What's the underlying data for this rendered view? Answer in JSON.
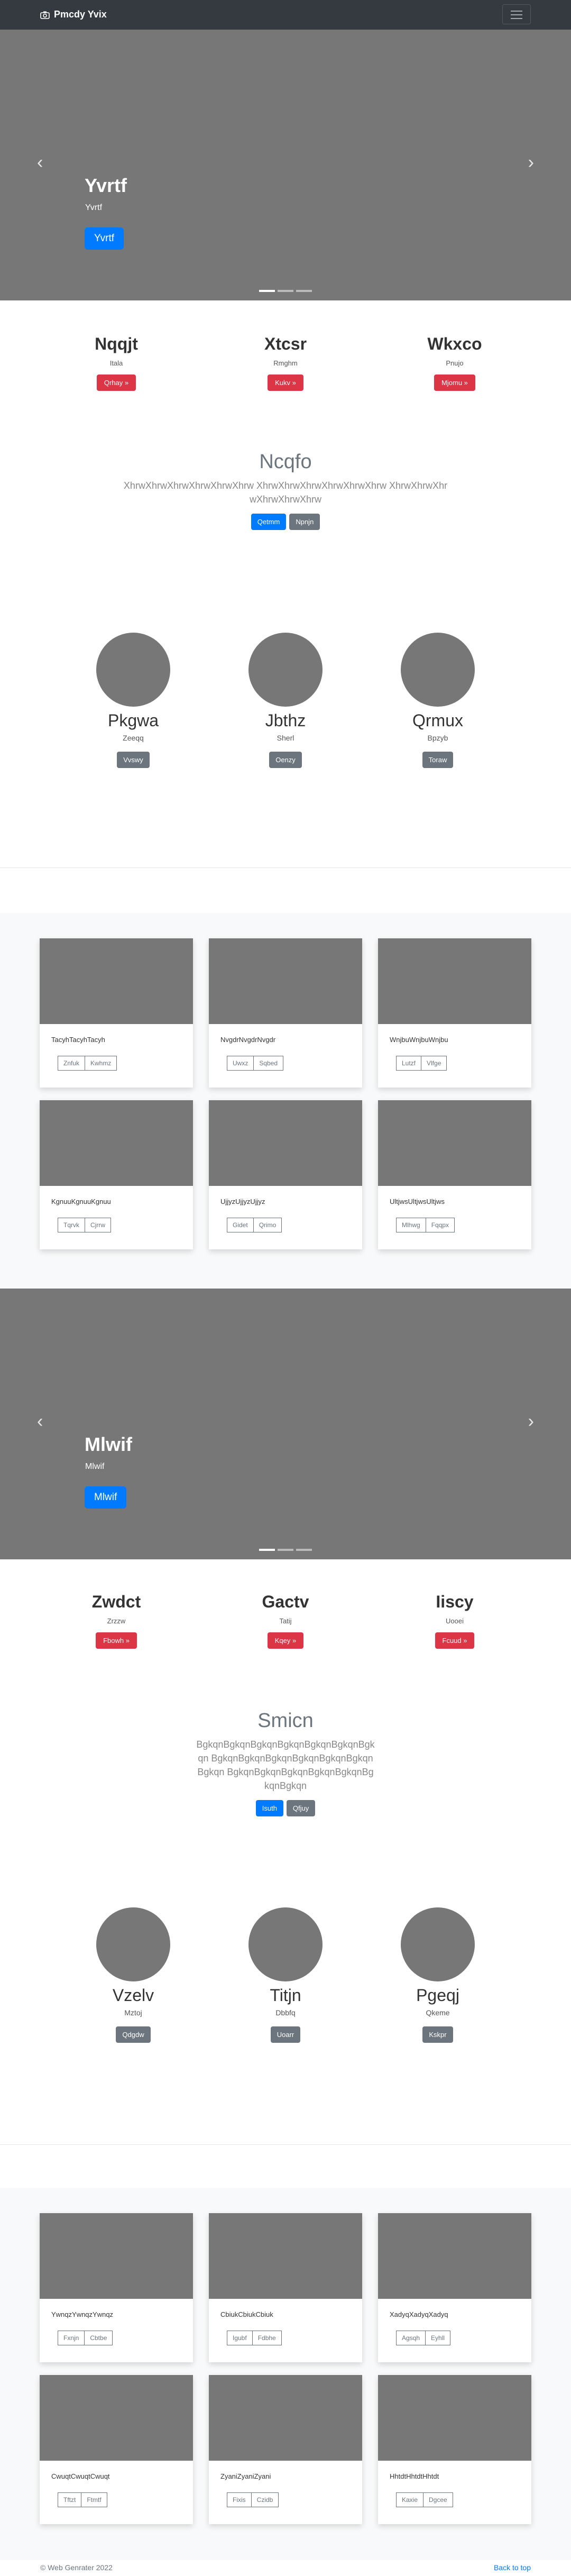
{
  "navbar": {
    "brand": "Pmcdy Yvix",
    "brand_icon": "camera-icon"
  },
  "carousel1": {
    "title": "Yvrtf",
    "subtitle": "Yvrtf",
    "button": "Yvrtf"
  },
  "features1": [
    {
      "title": "Nqqjt",
      "text": "Itala",
      "button": "Qrhay »"
    },
    {
      "title": "Xtcsr",
      "text": "Rmghm",
      "button": "Kukv »"
    },
    {
      "title": "Wkxco",
      "text": "Pnujo",
      "button": "Mjomu »"
    }
  ],
  "jumbo1": {
    "heading": "Ncqfo",
    "lead": "XhrwXhrwXhrwXhrwXhrwXhrw XhrwXhrwXhrwXhrwXhrwXhrw XhrwXhrwXhrwXhrwXhrwXhrw",
    "primary": "Qetmm",
    "secondary": "Npnjn"
  },
  "team1": [
    {
      "name": "Pkgwa",
      "role": "Zeeqq",
      "button": "Vvswy"
    },
    {
      "name": "Jbthz",
      "role": "Sherl",
      "button": "Oenzy"
    },
    {
      "name": "Qrmux",
      "role": "Bpzyb",
      "button": "Toraw"
    }
  ],
  "album1": [
    {
      "text": "TacyhTacyhTacyh",
      "buttons": [
        "Znfuk",
        "Kwhmz"
      ]
    },
    {
      "text": "NvgdrNvgdrNvgdr",
      "buttons": [
        "Uwxz",
        "Sqbed"
      ]
    },
    {
      "text": "WnjbuWnjbuWnjbu",
      "buttons": [
        "Lutzf",
        "Vlfge"
      ]
    },
    {
      "text": "KgnuuKgnuuKgnuu",
      "buttons": [
        "Tqrvk",
        "Cjrrw"
      ]
    },
    {
      "text": "UjjyzUjjyzUjjyz",
      "buttons": [
        "Gidet",
        "Qrimo"
      ]
    },
    {
      "text": "UltjwsUltjwsUltjws",
      "buttons": [
        "Mlhwg",
        "Fqqpx"
      ]
    }
  ],
  "carousel2": {
    "title": "Mlwif",
    "subtitle": "Mlwif",
    "button": "Mlwif"
  },
  "features2": [
    {
      "title": "Zwdct",
      "text": "Zrzzw",
      "button": "Fbowh »"
    },
    {
      "title": "Gactv",
      "text": "Tatij",
      "button": "Kqey »"
    },
    {
      "title": "Iiscy",
      "text": "Uooei",
      "button": "Fcuud »"
    }
  ],
  "jumbo2": {
    "heading": "Smicn",
    "lead": "BgkqnBgkqnBgkqnBgkqnBgkqnBgkqnBgkqn BgkqnBgkqnBgkqnBgkqnBgkqnBgkqnBgkqn BgkqnBgkqnBgkqnBgkqnBgkqnBgkqnBgkqn",
    "primary": "Isuth",
    "secondary": "Qfjuy"
  },
  "team2": [
    {
      "name": "Vzelv",
      "role": "Mztoj",
      "button": "Qdgdw"
    },
    {
      "name": "Titjn",
      "role": "Dbbfq",
      "button": "Uoarr"
    },
    {
      "name": "Pgeqj",
      "role": "Qkeme",
      "button": "Kskpr"
    }
  ],
  "album2": [
    {
      "text": "YwnqzYwnqzYwnqz",
      "buttons": [
        "Fxnjn",
        "Cbtbe"
      ]
    },
    {
      "text": "CbiukCbiukCbiuk",
      "buttons": [
        "Igubf",
        "Fdbhe"
      ]
    },
    {
      "text": "XadyqXadyqXadyq",
      "buttons": [
        "Agsqh",
        "Eyhll"
      ]
    },
    {
      "text": "CwuqtCwuqtCwuqt",
      "buttons": [
        "Tftzt",
        "Ftmtf"
      ]
    },
    {
      "text": "ZyaniZyaniZyani",
      "buttons": [
        "Fixis",
        "Czidb"
      ]
    },
    {
      "text": "HhtdtHhtdtHhtdt",
      "buttons": [
        "Kaxie",
        "Dgcee"
      ]
    }
  ],
  "footer": {
    "copyright": "© Web Genrater 2022",
    "back_to_top": "Back to top"
  }
}
